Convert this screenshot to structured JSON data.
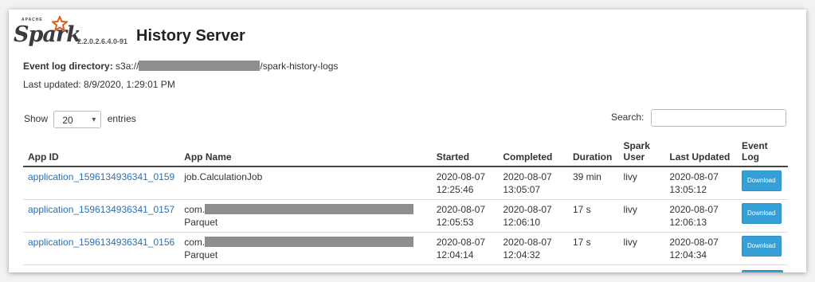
{
  "header": {
    "apache_text": "APACHE",
    "logo_text": "Spark",
    "version": "2.2.0.2.6.4.0-91",
    "title": "History Server"
  },
  "meta": {
    "event_log_label": "Event log directory:",
    "event_log_prefix": "s3a://",
    "event_log_suffix": "/spark-history-logs",
    "last_updated": "Last updated: 8/9/2020, 1:29:01 PM"
  },
  "controls": {
    "show_label": "Show",
    "page_size": "20",
    "entries_label": "entries",
    "search_label": "Search:",
    "search_value": ""
  },
  "table": {
    "headers": [
      "App ID",
      "App Name",
      "Started",
      "Completed",
      "Duration",
      "Spark User",
      "Last Updated",
      "Event Log"
    ],
    "rows": [
      {
        "app_id": "application_1596134936341_0159",
        "app_name_prefix": "job.CalculationJob",
        "app_name_suffix": "",
        "started_date": "2020-08-07",
        "started_time": "12:25:46",
        "completed_date": "2020-08-07",
        "completed_time": "13:05:07",
        "duration": "39 min",
        "user": "livy",
        "last_updated_date": "2020-08-07",
        "last_updated_time": "13:05:12",
        "download": "Download"
      },
      {
        "app_id": "application_1596134936341_0157",
        "app_name_prefix": "com.",
        "app_name_suffix": "Parquet",
        "started_date": "2020-08-07",
        "started_time": "12:05:53",
        "completed_date": "2020-08-07",
        "completed_time": "12:06:10",
        "duration": "17 s",
        "user": "livy",
        "last_updated_date": "2020-08-07",
        "last_updated_time": "12:06:13",
        "download": "Download"
      },
      {
        "app_id": "application_1596134936341_0156",
        "app_name_prefix": "com.",
        "app_name_suffix": "Parquet",
        "started_date": "2020-08-07",
        "started_time": "12:04:14",
        "completed_date": "2020-08-07",
        "completed_time": "12:04:32",
        "duration": "17 s",
        "user": "livy",
        "last_updated_date": "2020-08-07",
        "last_updated_time": "12:04:34",
        "download": "Download"
      }
    ]
  },
  "colors": {
    "link": "#2a6fb8",
    "download_button": "#35a0d8",
    "redaction": "#8e8e8e",
    "spark_star": "#e25a1c"
  }
}
